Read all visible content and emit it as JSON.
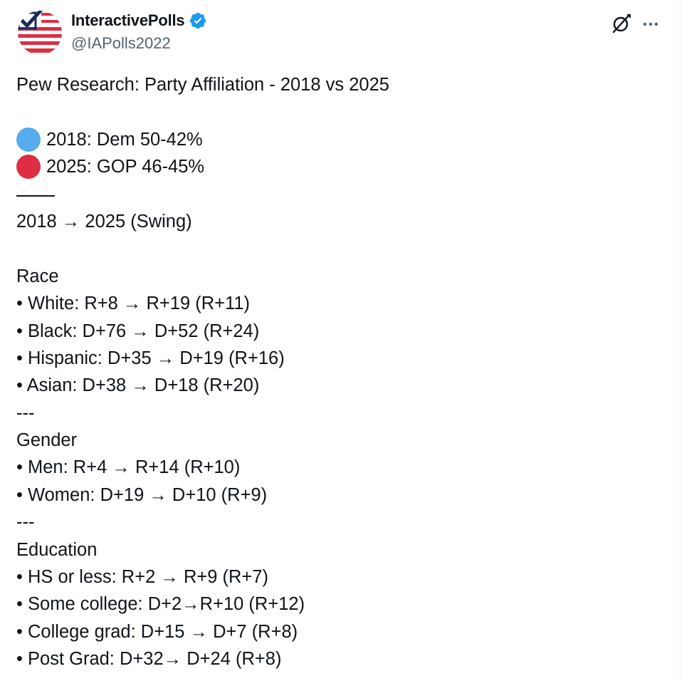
{
  "author": {
    "display_name": "InteractivePolls",
    "handle": "@IAPolls2022",
    "verified": true,
    "avatar_icon": "us-flag-checkbox-logo"
  },
  "actions": {
    "grok_icon": "grok-icon",
    "more_icon": "more-icon"
  },
  "tweet": {
    "title": "Pew Research: Party Affiliation - 2018 vs 2025",
    "line_2018": "2018: Dem 50-42%",
    "line_2025": "2025: GOP 46-45%",
    "rule": "——",
    "swing_header": "2018 → 2025 (Swing)",
    "sections": [
      {
        "heading": "Race",
        "items": [
          "• White: R+8 → R+19 (R+11)",
          "• Black: D+76 → D+52 (R+24)",
          "• Hispanic: D+35 → D+19 (R+16)",
          "• Asian: D+38 → D+18 (R+20)"
        ]
      },
      {
        "heading": "Gender",
        "items": [
          "• Men: R+4 → R+14 (R+10)",
          "• Women: D+19 → D+10 (R+9)"
        ]
      },
      {
        "heading": "Education",
        "items": [
          "• HS or less: R+2 → R+9 (R+7)",
          "• Some college: D+2→R+10 (R+12)",
          "• College grad: D+15 → D+7 (R+8)",
          "• Post Grad: D+32→ D+24 (R+8)"
        ]
      }
    ],
    "separator": "---"
  },
  "colors": {
    "blue_circle": "#55acee",
    "red_circle": "#dd2e44",
    "verified_badge": "#1d9bf0",
    "text_primary": "#0f1419",
    "text_secondary": "#536471"
  }
}
